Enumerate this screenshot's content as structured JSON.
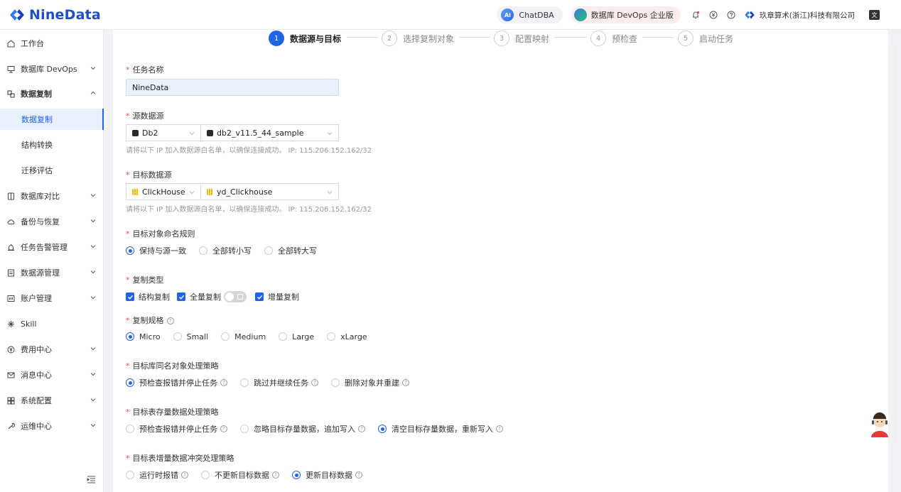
{
  "header": {
    "logo_text": "NineData",
    "chatdba_label": "ChatDBA",
    "chatdba_ai": "AI",
    "devops_label": "数据库 DevOps 企业版",
    "company": "玖章算术(浙江)科技有限公司",
    "lang_glyph": "文"
  },
  "sidebar": {
    "items": [
      {
        "label": "工作台"
      },
      {
        "label": "数据库 DevOps"
      },
      {
        "label": "数据复制"
      },
      {
        "label": "数据复制"
      },
      {
        "label": "结构转换"
      },
      {
        "label": "迁移评估"
      },
      {
        "label": "数据库对比"
      },
      {
        "label": "备份与恢复"
      },
      {
        "label": "任务告警管理"
      },
      {
        "label": "数据源管理"
      },
      {
        "label": "账户管理"
      },
      {
        "label": "Skill"
      },
      {
        "label": "费用中心"
      },
      {
        "label": "消息中心"
      },
      {
        "label": "系统配置"
      },
      {
        "label": "运维中心"
      }
    ]
  },
  "steps": [
    {
      "num": "1",
      "label": "数据源与目标"
    },
    {
      "num": "2",
      "label": "选择复制对象"
    },
    {
      "num": "3",
      "label": "配置映射"
    },
    {
      "num": "4",
      "label": "预检查"
    },
    {
      "num": "5",
      "label": "启动任务"
    }
  ],
  "form": {
    "task_name_label": "任务名称",
    "task_name_value": "NineData",
    "source_label": "源数据源",
    "source_type": "Db2",
    "source_instance": "db2_v11.5_44_sample",
    "ip_hint": "请将以下 IP 加入数据源白名单，以确保连接成功。 IP: 115.206.152.162/32",
    "target_label": "目标数据源",
    "target_type": "ClickHouse",
    "target_instance": "yd_Clickhouse",
    "naming_label": "目标对象命名规则",
    "naming_options": [
      "保持与源一致",
      "全部转小写",
      "全部转大写"
    ],
    "copy_type_label": "复制类型",
    "copy_types": [
      "结构复制",
      "全量复制",
      "增量复制"
    ],
    "spec_label": "复制规格",
    "spec_options": [
      "Micro",
      "Small",
      "Medium",
      "Large",
      "xLarge"
    ],
    "same_name_label": "目标库同名对象处理策略",
    "same_name_options": [
      "预检查报错并停止任务",
      "跳过并继续任务",
      "删除对象并重建"
    ],
    "existing_data_label": "目标表存量数据处理策略",
    "existing_data_options": [
      "预检查报错并停止任务",
      "忽略目标存量数据，追加写入",
      "清空目标存量数据，重新写入"
    ],
    "conflict_label": "目标表增量数据冲突处理策略",
    "conflict_options": [
      "运行时报错",
      "不更新目标数据",
      "更新目标数据"
    ]
  },
  "colors": {
    "accent": "#1f63e8",
    "required": "#e54b4b",
    "brand": "#1f4fc8"
  }
}
